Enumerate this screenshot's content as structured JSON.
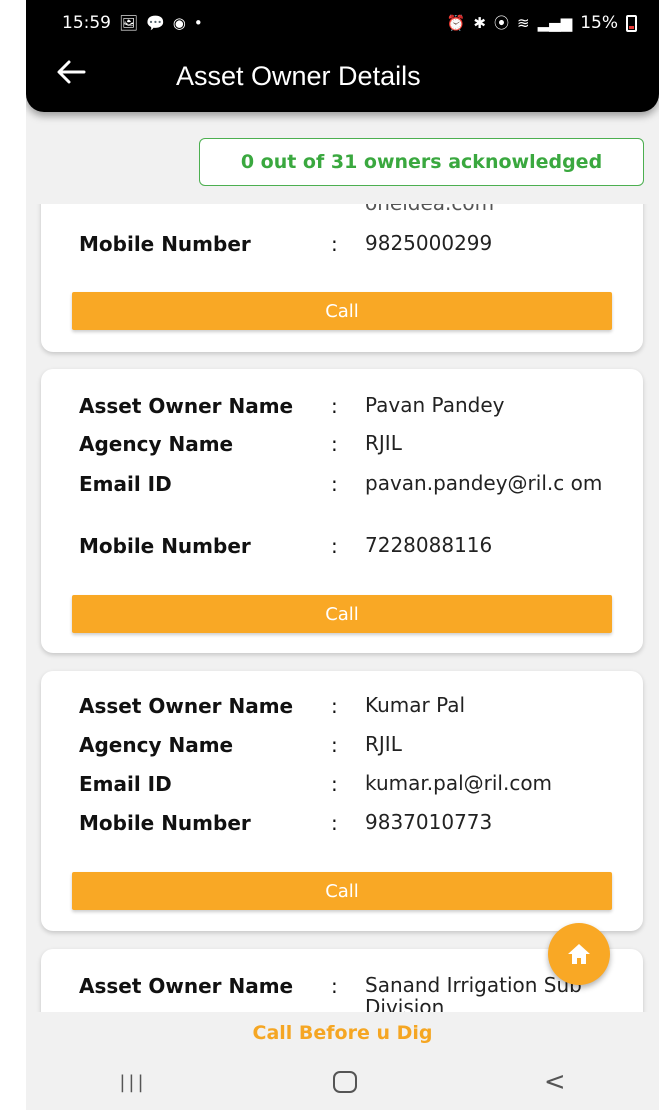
{
  "status_bar": {
    "time": "15:59",
    "battery": "15%",
    "left_icons": [
      "image-icon",
      "message-icon",
      "app-icon",
      "dot"
    ],
    "right_icons": [
      "alarm-icon",
      "vibrate-icon",
      "location-icon",
      "wifi-icon",
      "signal-icon",
      "volte-icon",
      "signal-icon"
    ]
  },
  "header": {
    "title": "Asset Owner Details",
    "back_icon": "back-arrow-icon"
  },
  "acknowledgement": {
    "text": "0 out of 31 owners acknowledged",
    "color": "#3aa83f"
  },
  "labels": {
    "asset_owner_name": "Asset Owner Name",
    "agency_name": "Agency Name",
    "email_id": "Email ID",
    "mobile_number": "Mobile Number",
    "colon": ":",
    "call": "Call"
  },
  "cards": [
    {
      "email_tail": "oneidea.com",
      "mobile": "9825000299"
    },
    {
      "owner_name": "Pavan Pandey",
      "agency": "RJIL",
      "email": "pavan.pandey@ril.c om",
      "mobile": "7228088116"
    },
    {
      "owner_name": "Kumar Pal",
      "agency": "RJIL",
      "email": "kumar.pal@ril.com",
      "mobile": "9837010773"
    },
    {
      "owner_name": "Sanand Irrigation Sub Division"
    }
  ],
  "footer": {
    "brand": "Call Before u Dig",
    "brand_color": "#f5a623"
  },
  "nav": {
    "recent_glyph": "|||",
    "back_glyph": "<"
  },
  "colors": {
    "accent": "#f9a825",
    "appbar": "#000000",
    "background": "#f1f1f1"
  }
}
